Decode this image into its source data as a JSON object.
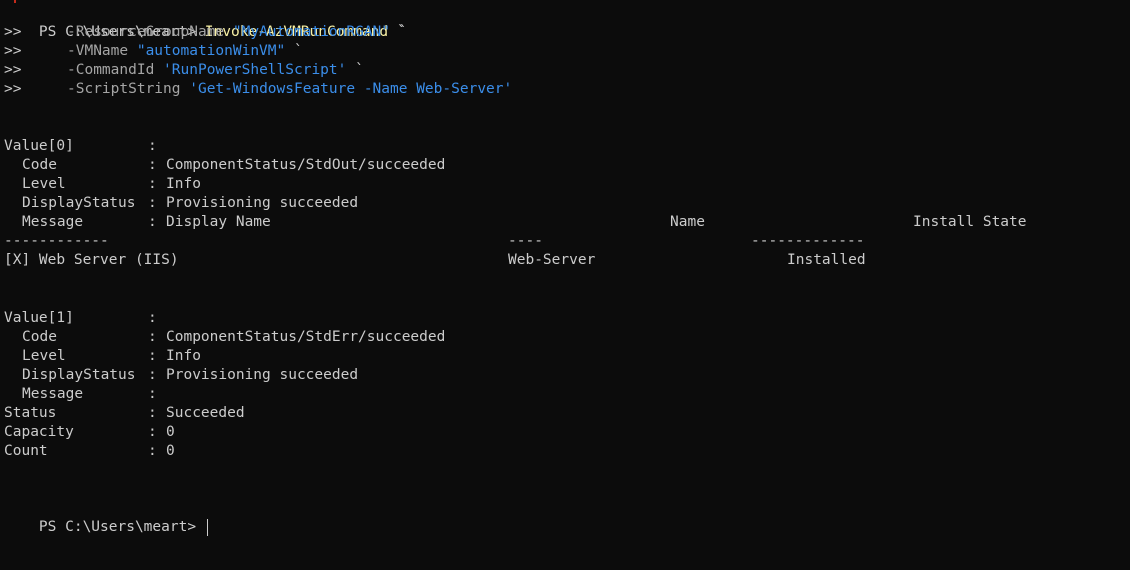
{
  "command": {
    "prompt": "PS C:\\Users\\meart> ",
    "cmdlet": "Invoke-AzVMRunCommand",
    "continuation": " `",
    "cont_prefix": ">>",
    "params": [
      {
        "name": "-ResourceGroupName",
        "value": "\"MyAutomationRGAN\"",
        "tail": " `"
      },
      {
        "name": "-VMName",
        "value": "\"automationWinVM\"",
        "tail": " `"
      },
      {
        "name": "-CommandId",
        "value": "'RunPowerShellScript'",
        "tail": " `"
      },
      {
        "name": "-ScriptString",
        "value": "'Get-WindowsFeature -Name Web-Server'",
        "tail": ""
      }
    ]
  },
  "output": {
    "value0": {
      "label": "Value[0]",
      "sep": ":",
      "fields": [
        {
          "key": "Code",
          "value": "ComponentStatus/StdOut/succeeded"
        },
        {
          "key": "Level",
          "value": "Info"
        },
        {
          "key": "DisplayStatus",
          "value": "Provisioning succeeded"
        },
        {
          "key": "Message",
          "value": "Display Name"
        }
      ],
      "table": {
        "col_name": "Name",
        "col_state": "Install State",
        "rule_display": "------------",
        "rule_name": "----",
        "rule_state": "-------------",
        "row_display": "[X] Web Server (IIS)",
        "row_name": "Web-Server",
        "row_state": "Installed"
      }
    },
    "value1": {
      "label": "Value[1]",
      "sep": ":",
      "fields": [
        {
          "key": "Code",
          "value": "ComponentStatus/StdErr/succeeded"
        },
        {
          "key": "Level",
          "value": "Info"
        },
        {
          "key": "DisplayStatus",
          "value": "Provisioning succeeded"
        },
        {
          "key": "Message",
          "value": ""
        }
      ]
    },
    "summary": [
      {
        "key": "Status",
        "value": "Succeeded"
      },
      {
        "key": "Capacity",
        "value": "0"
      },
      {
        "key": "Count",
        "value": "0"
      }
    ]
  },
  "final_prompt": "PS C:\\Users\\meart> ",
  "colors": {
    "background": "#0c0c0c",
    "text": "#cccccc",
    "cmdlet": "#f9f1a5",
    "parameter": "#a5a5a5",
    "string": "#3b8eea"
  }
}
